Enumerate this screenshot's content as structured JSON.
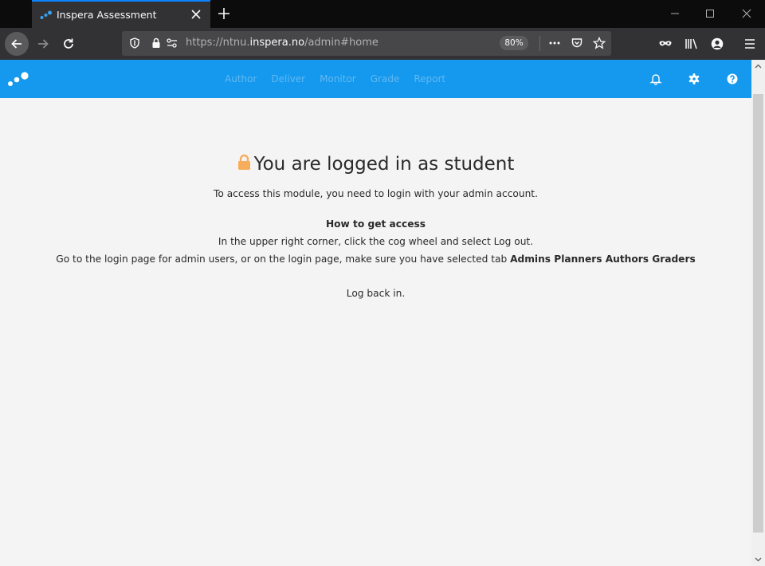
{
  "browser": {
    "tab_title": "Inspera Assessment",
    "url_prefix": "https://ntnu.",
    "url_domain": "inspera.no",
    "url_path": "/admin#home",
    "zoom": "80%"
  },
  "app": {
    "nav": [
      "Author",
      "Deliver",
      "Monitor",
      "Grade",
      "Report"
    ],
    "accent_color": "#1499ee"
  },
  "message": {
    "title": "You are logged in as student",
    "subtitle": "To access this module, you need to login with your admin account.",
    "howto_heading": "How to get access",
    "step1": "In the upper right corner, click the cog wheel and select Log out.",
    "step2_prefix": "Go to the login page for admin users, or on the login page, make sure you have selected tab",
    "step2_bold": "Admins Planners Authors Graders",
    "step3": "Log back in."
  }
}
